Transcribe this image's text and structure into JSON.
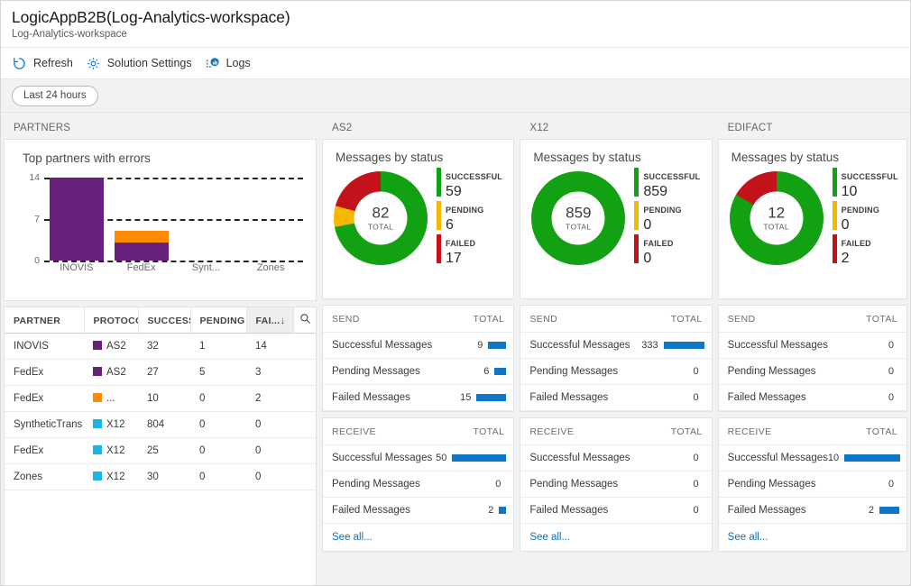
{
  "header": {
    "title": "LogicAppB2B(Log-Analytics-workspace)",
    "subtitle": "Log-Analytics-workspace"
  },
  "toolbar": {
    "refresh_label": "Refresh",
    "settings_label": "Solution Settings",
    "logs_label": "Logs",
    "icons": {
      "refresh": "refresh-icon",
      "settings": "gear-icon",
      "logs": "bar-chart-icon"
    }
  },
  "filter": {
    "time_range": "Last 24 hours"
  },
  "colors": {
    "successful": "#12a112",
    "pending": "#f5b800",
    "failed": "#c3121a",
    "as2": "#68217a",
    "edifact": "#ff8c00",
    "x12": "#19b5e8",
    "bar_blue": "#0f77c8",
    "link": "#0e70c0"
  },
  "sections": {
    "partners": "PARTNERS",
    "as2": "AS2",
    "x12": "X12",
    "edifact": "EDIFACT"
  },
  "chart_data": [
    {
      "type": "bar",
      "title": "Top partners with errors",
      "categories": [
        "INOVIS",
        "FedEx",
        "Synt...",
        "Zones"
      ],
      "series": [
        {
          "name": "AS2",
          "color": "#68217a",
          "values": [
            14,
            3,
            0,
            0
          ]
        },
        {
          "name": "EDIFACT",
          "color": "#ff8c00",
          "values": [
            0,
            2,
            0,
            0
          ]
        }
      ],
      "stacked": true,
      "ylabel": "",
      "xlabel": "",
      "ylim": [
        0,
        14
      ],
      "yticks": [
        0,
        7,
        14
      ],
      "grid": true
    },
    {
      "type": "pie",
      "title": "Messages by status",
      "panel": "AS2",
      "total": 82,
      "total_label": "TOTAL",
      "labels": [
        "SUCCESSFUL",
        "PENDING",
        "FAILED"
      ],
      "values": [
        59,
        6,
        17
      ],
      "colors": [
        "#12a112",
        "#f5b800",
        "#c3121a"
      ],
      "legend": "right"
    },
    {
      "type": "pie",
      "title": "Messages by status",
      "panel": "X12",
      "total": 859,
      "total_label": "TOTAL",
      "labels": [
        "SUCCESSFUL",
        "PENDING",
        "FAILED"
      ],
      "values": [
        859,
        0,
        0
      ],
      "colors": [
        "#12a112",
        "#f5b800",
        "#c3121a"
      ],
      "legend": "right"
    },
    {
      "type": "pie",
      "title": "Messages by status",
      "panel": "EDIFACT",
      "total": 12,
      "total_label": "TOTAL",
      "labels": [
        "SUCCESSFUL",
        "PENDING",
        "FAILED"
      ],
      "values": [
        10,
        0,
        2
      ],
      "colors": [
        "#12a112",
        "#f5b800",
        "#c3121a"
      ],
      "legend": "right"
    }
  ],
  "partners_table": {
    "columns": [
      "PARTNER",
      "PROTOCOL",
      "SUCCESS",
      "PENDING",
      "FAI..."
    ],
    "sorted_column": "FAI...",
    "sort_direction": "desc",
    "search_icon": "search-icon",
    "rows": [
      {
        "partner": "INOVIS",
        "protocol": "AS2",
        "protocol_color": "#68217a",
        "success": "32",
        "pending": "1",
        "failed": "14"
      },
      {
        "partner": "FedEx",
        "protocol": "AS2",
        "protocol_color": "#68217a",
        "success": "27",
        "pending": "5",
        "failed": "3"
      },
      {
        "partner": "FedEx",
        "protocol": "...",
        "protocol_color": "#ff8c00",
        "success": "10",
        "pending": "0",
        "failed": "2"
      },
      {
        "partner": "SyntheticTrans",
        "protocol": "X12",
        "protocol_color": "#19b5e8",
        "success": "804",
        "pending": "0",
        "failed": "0"
      },
      {
        "partner": "FedEx",
        "protocol": "X12",
        "protocol_color": "#19b5e8",
        "success": "25",
        "pending": "0",
        "failed": "0"
      },
      {
        "partner": "Zones",
        "protocol": "X12",
        "protocol_color": "#19b5e8",
        "success": "30",
        "pending": "0",
        "failed": "0"
      }
    ]
  },
  "protocol_panels": [
    {
      "key": "as2",
      "donut_title": "Messages by status",
      "total": "82",
      "total_label": "TOTAL",
      "legend": [
        {
          "name": "SUCCESSFUL",
          "value": "59"
        },
        {
          "name": "PENDING",
          "value": "6"
        },
        {
          "name": "FAILED",
          "value": "17"
        }
      ],
      "send": {
        "header": "SEND",
        "total_header": "TOTAL",
        "items": [
          {
            "label": "Successful Messages",
            "value": "9",
            "bar": 20
          },
          {
            "label": "Pending Messages",
            "value": "6",
            "bar": 13
          },
          {
            "label": "Failed Messages",
            "value": "15",
            "bar": 33
          }
        ]
      },
      "receive": {
        "header": "RECEIVE",
        "total_header": "TOTAL",
        "items": [
          {
            "label": "Successful Messages",
            "value": "50",
            "bar": 60
          },
          {
            "label": "Pending Messages",
            "value": "0",
            "bar": 0
          },
          {
            "label": "Failed Messages",
            "value": "2",
            "bar": 8
          }
        ]
      },
      "see_all": "See all..."
    },
    {
      "key": "x12",
      "donut_title": "Messages by status",
      "total": "859",
      "total_label": "TOTAL",
      "legend": [
        {
          "name": "SUCCESSFUL",
          "value": "859"
        },
        {
          "name": "PENDING",
          "value": "0"
        },
        {
          "name": "FAILED",
          "value": "0"
        }
      ],
      "send": {
        "header": "SEND",
        "total_header": "TOTAL",
        "items": [
          {
            "label": "Successful Messages",
            "value": "333",
            "bar": 45
          },
          {
            "label": "Pending Messages",
            "value": "0",
            "bar": 0
          },
          {
            "label": "Failed Messages",
            "value": "0",
            "bar": 0
          }
        ]
      },
      "receive": {
        "header": "RECEIVE",
        "total_header": "TOTAL",
        "items": [
          {
            "label": "Successful Messages",
            "value": "0",
            "bar": 0
          },
          {
            "label": "Pending Messages",
            "value": "0",
            "bar": 0
          },
          {
            "label": "Failed Messages",
            "value": "0",
            "bar": 0
          }
        ]
      },
      "see_all": "See all..."
    },
    {
      "key": "edifact",
      "donut_title": "Messages by status",
      "total": "12",
      "total_label": "TOTAL",
      "legend": [
        {
          "name": "SUCCESSFUL",
          "value": "10"
        },
        {
          "name": "PENDING",
          "value": "0"
        },
        {
          "name": "FAILED",
          "value": "2"
        }
      ],
      "send": {
        "header": "SEND",
        "total_header": "TOTAL",
        "items": [
          {
            "label": "Successful Messages",
            "value": "0",
            "bar": 0
          },
          {
            "label": "Pending Messages",
            "value": "0",
            "bar": 0
          },
          {
            "label": "Failed Messages",
            "value": "0",
            "bar": 0
          }
        ]
      },
      "receive": {
        "header": "RECEIVE",
        "total_header": "TOTAL",
        "items": [
          {
            "label": "Successful Messages",
            "value": "10",
            "bar": 62
          },
          {
            "label": "Pending Messages",
            "value": "0",
            "bar": 0
          },
          {
            "label": "Failed Messages",
            "value": "2",
            "bar": 22
          }
        ]
      },
      "see_all": "See all..."
    }
  ]
}
